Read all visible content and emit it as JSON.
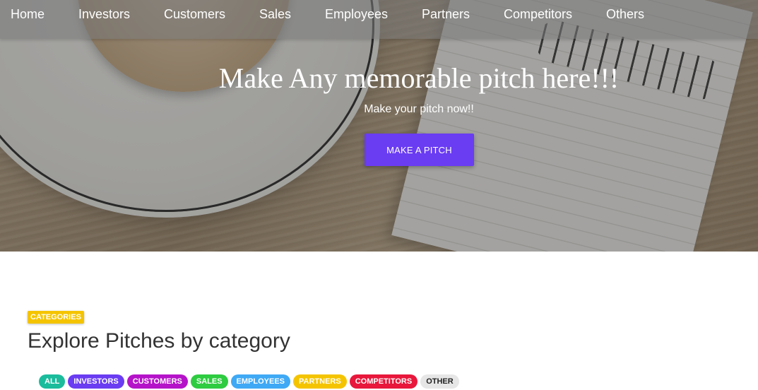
{
  "nav": {
    "items": [
      "Home",
      "Investors",
      "Customers",
      "Sales",
      "Employees",
      "Partners",
      "Competitors",
      "Others"
    ]
  },
  "hero": {
    "title": "Make Any memorable pitch here!!!",
    "subtitle": "Make your pitch now!!",
    "button_label": "MAKE A PITCH"
  },
  "categories": {
    "badge": "CATEGORIES",
    "title": "Explore Pitches by category",
    "chips": [
      {
        "label": "ALL",
        "color": "#1abc9c"
      },
      {
        "label": "INVESTORS",
        "color": "#6a3cf2"
      },
      {
        "label": "CUSTOMERS",
        "color": "#b513c9"
      },
      {
        "label": "SALES",
        "color": "#2ecc40"
      },
      {
        "label": "EMPLOYEES",
        "color": "#3fa9f5"
      },
      {
        "label": "PARTNERS",
        "color": "#f5c400"
      },
      {
        "label": "COMPETITORS",
        "color": "#e8173b"
      },
      {
        "label": "OTHER",
        "color": "#e6e6e6"
      }
    ]
  },
  "colors": {
    "accent": "#6a3cf2",
    "badge": "#f5c400"
  }
}
